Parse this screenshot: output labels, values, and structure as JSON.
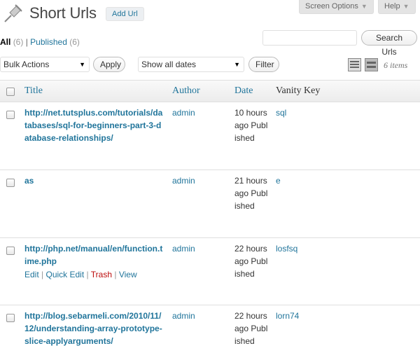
{
  "header": {
    "title": "Short Urls",
    "add_label": "Add Url",
    "screen_options": "Screen Options",
    "help": "Help"
  },
  "views": {
    "all_label": "All",
    "all_count": "(6)",
    "sep": "|",
    "published_label": "Published",
    "published_count": "(6)"
  },
  "search": {
    "button": "Search Urls",
    "value": ""
  },
  "actions": {
    "bulk": "Bulk Actions",
    "apply": "Apply",
    "dates": "Show all dates",
    "filter": "Filter",
    "items_count": "6 items"
  },
  "columns": {
    "title": "Title",
    "author": "Author",
    "date": "Date",
    "vanity": "Vanity Key"
  },
  "rows": [
    {
      "title": "http://net.tutsplus.com/tutorials/databases/sql-for-beginners-part-3-database-relationships/",
      "author": "admin",
      "date": "10 hours ago Published",
      "vanity": "sql"
    },
    {
      "title": "as",
      "author": "admin",
      "date": "21 hours ago Published",
      "vanity": "e"
    },
    {
      "title": "http://php.net/manual/en/function.time.php",
      "author": "admin",
      "date": "22 hours ago Published",
      "vanity": "losfsq",
      "row_actions": {
        "edit": "Edit",
        "quick_edit": "Quick Edit",
        "trash": "Trash",
        "view": "View",
        "sep": "|"
      }
    },
    {
      "title": "http://blog.sebarmeli.com/2010/11/12/understanding-array-prototype-slice-applyarguments/",
      "author": "admin",
      "date": "22 hours ago Published",
      "vanity": "lorn74"
    }
  ]
}
